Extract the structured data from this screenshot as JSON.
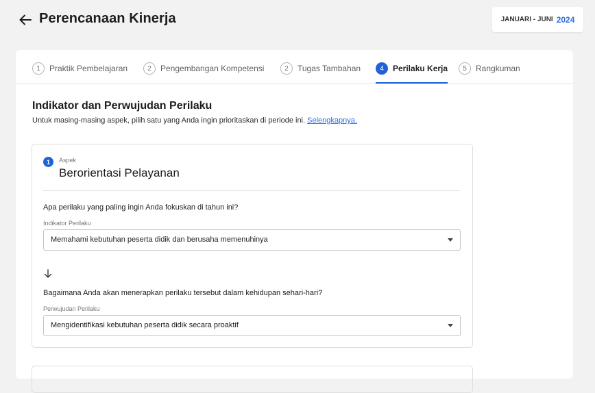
{
  "header": {
    "title": "Perencanaan Kinerja",
    "period_label": "JANUARI - JUNI",
    "period_year": "2024"
  },
  "steps": [
    {
      "num": "1",
      "label": "Praktik Pembelajaran",
      "active": false
    },
    {
      "num": "2",
      "label": "Pengembangan Kompetensi",
      "active": false
    },
    {
      "num": "2",
      "label": "Tugas Tambahan",
      "active": false
    },
    {
      "num": "4",
      "label": "Perilaku Kerja",
      "active": true
    },
    {
      "num": "5",
      "label": "Rangkuman",
      "active": false
    }
  ],
  "section": {
    "title": "Indikator dan Perwujudan Perilaku",
    "description": "Untuk masing-masing aspek, pilih satu yang Anda ingin prioritaskan di periode ini.",
    "link_text": "Selengkapnya."
  },
  "aspect": {
    "number": "1",
    "caption": "Aspek",
    "name": "Berorientasi Pelayanan",
    "question1": "Apa perilaku yang paling ingin Anda fokuskan di tahun ini?",
    "indicator_label": "Indikator Perilaku",
    "indicator_value": "Memahami kebutuhan peserta didik dan berusaha memenuhinya",
    "question2": "Bagaimana Anda akan menerapkan perilaku tersebut dalam kehidupan sehari-hari?",
    "manifestation_label": "Perwujudan Perilaku",
    "manifestation_value": "Mengidentifikasi kebutuhan peserta didik secara proaktif"
  },
  "icons": {
    "back": "arrow-left-icon",
    "dropdown": "caret-down-icon",
    "flow": "arrow-down-icon"
  },
  "colors": {
    "accent": "#1f63d6",
    "link": "#2f6fdb",
    "background": "#f2f2f2"
  }
}
